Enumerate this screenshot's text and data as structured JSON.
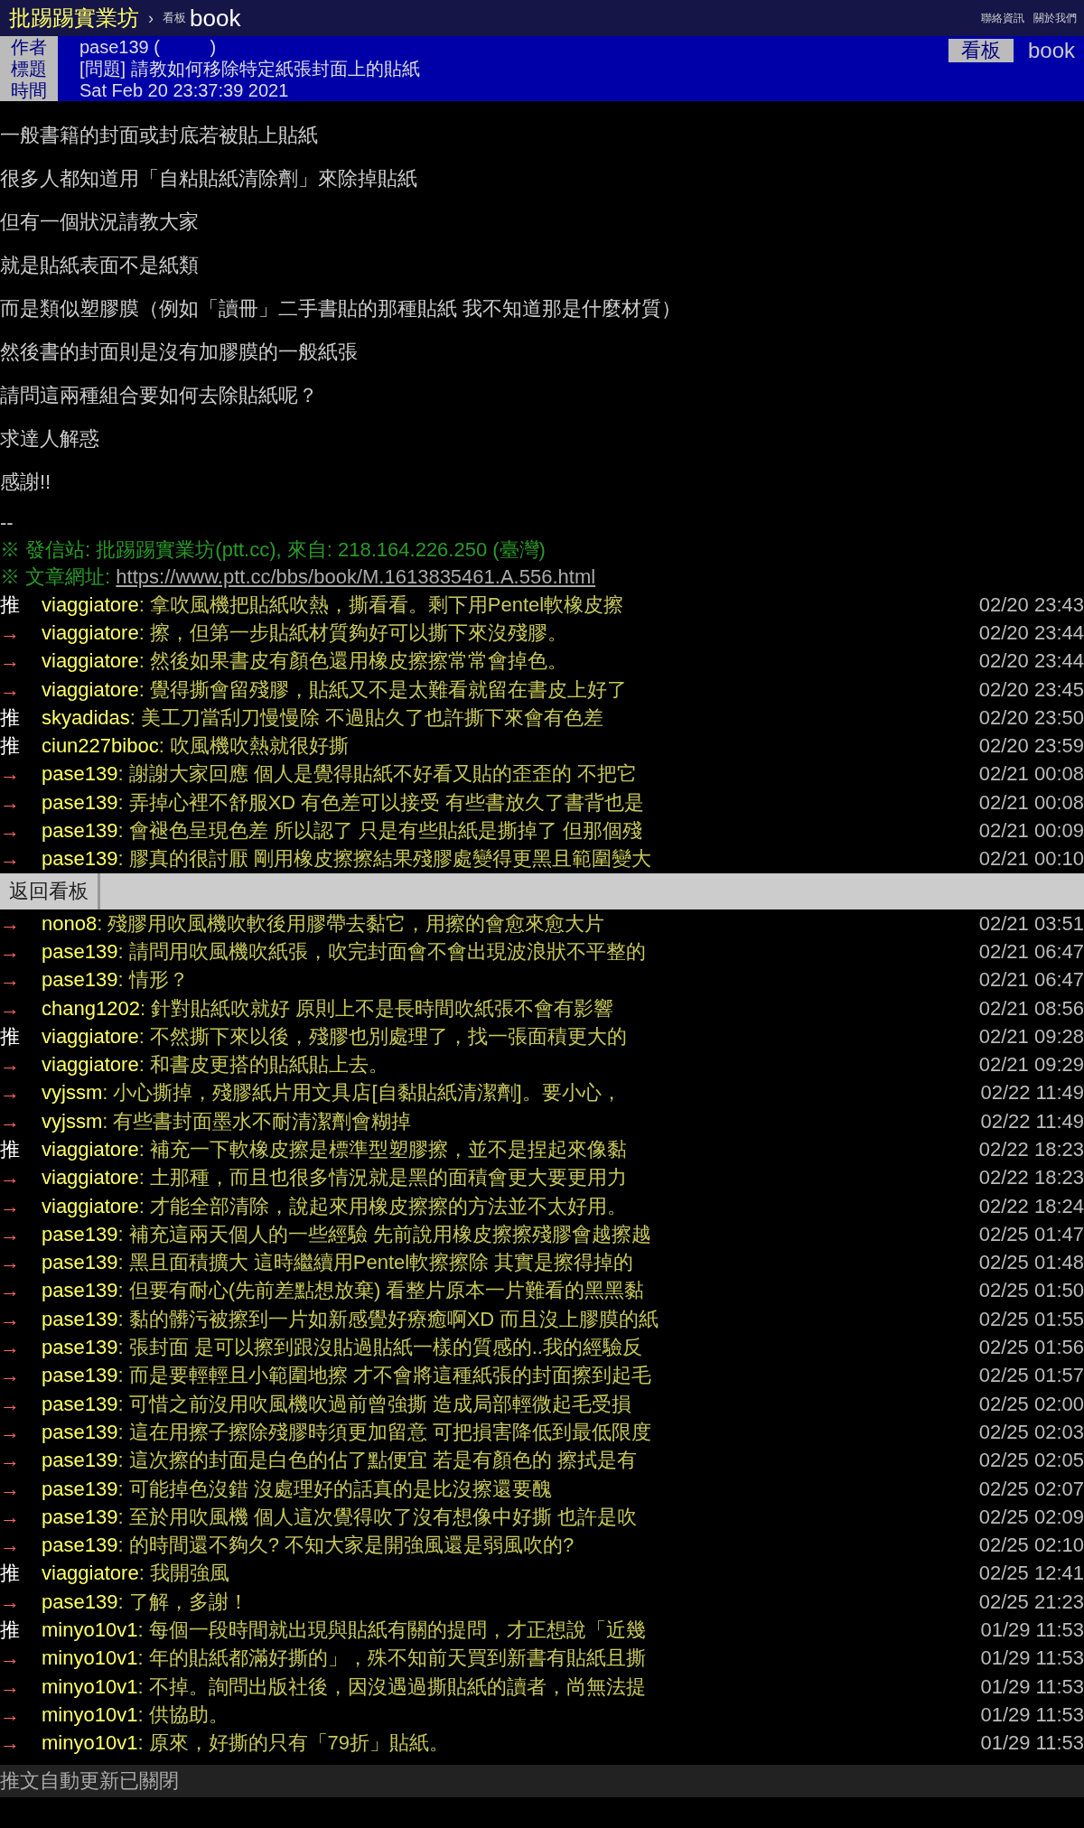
{
  "topbar": {
    "site": "批踢踢實業坊",
    "separator": "›",
    "board_label": "看板",
    "board": "book",
    "links": [
      "聯絡資訊",
      "關於我們"
    ]
  },
  "meta": {
    "rows": [
      {
        "label": "作者",
        "value": "pase139 (          )"
      },
      {
        "label": "標題",
        "value": "[問題] 請教如何移除特定紙張封面上的貼紙"
      },
      {
        "label": "時間",
        "value": "Sat Feb 20 23:37:39 2021"
      }
    ],
    "board_tag": {
      "label": "看板",
      "value": "book"
    }
  },
  "body": [
    "一般書籍的封面或封底若被貼上貼紙",
    "很多人都知道用「自粘貼紙清除劑」來除掉貼紙",
    "但有一個狀況請教大家",
    "就是貼紙表面不是紙類",
    "而是類似塑膠膜（例如「讀冊」二手書貼的那種貼紙 我不知道那是什麼材質）",
    "然後書的封面則是沒有加膠膜的一般紙張",
    "請問這兩種組合要如何去除貼紙呢？",
    "求達人解惑",
    "感謝!!"
  ],
  "signature": "--",
  "source_lines": [
    {
      "kind": "text",
      "label": "※ 發信站:",
      "value": "批踢踢實業坊(ptt.cc), 來自: 218.164.226.250 (臺灣)"
    },
    {
      "kind": "link",
      "label": "※ 文章網址:",
      "value": "https://www.ptt.cc/bbs/book/M.1613835461.A.556.html"
    }
  ],
  "pushes": [
    {
      "kind": "push",
      "tag": "推",
      "user": "viaggiatore",
      "content": ": 拿吹風機把貼紙吹熱，撕看看。剩下用Pentel軟橡皮擦",
      "time": "02/20 23:43"
    },
    {
      "kind": "arrow",
      "tag": "→",
      "user": "viaggiatore",
      "content": ": 擦，但第一步貼紙材質夠好可以撕下來沒殘膠。",
      "time": "02/20 23:44"
    },
    {
      "kind": "arrow",
      "tag": "→",
      "user": "viaggiatore",
      "content": ": 然後如果書皮有顏色還用橡皮擦擦常常會掉色。",
      "time": "02/20 23:44"
    },
    {
      "kind": "arrow",
      "tag": "→",
      "user": "viaggiatore",
      "content": ": 覺得撕會留殘膠，貼紙又不是太難看就留在書皮上好了",
      "time": "02/20 23:45"
    },
    {
      "kind": "push",
      "tag": "推",
      "user": "skyadidas",
      "content": ": 美工刀當刮刀慢慢除 不過貼久了也許撕下來會有色差",
      "time": "02/20 23:50"
    },
    {
      "kind": "push",
      "tag": "推",
      "user": "ciun227biboc",
      "content": ": 吹風機吹熱就很好撕",
      "time": "02/20 23:59"
    },
    {
      "kind": "arrow",
      "tag": "→",
      "user": "pase139",
      "content": ": 謝謝大家回應 個人是覺得貼紙不好看又貼的歪歪的 不把它",
      "time": "02/21 00:08"
    },
    {
      "kind": "arrow",
      "tag": "→",
      "user": "pase139",
      "content": ": 弄掉心裡不舒服XD 有色差可以接受 有些書放久了書背也是",
      "time": "02/21 00:08"
    },
    {
      "kind": "arrow",
      "tag": "→",
      "user": "pase139",
      "content": ": 會褪色呈現色差 所以認了 只是有些貼紙是撕掉了 但那個殘",
      "time": "02/21 00:09"
    },
    {
      "kind": "arrow",
      "tag": "→",
      "user": "pase139",
      "content": ": 膠真的很討厭 剛用橡皮擦擦結果殘膠處變得更黑且範圍變大",
      "time": "02/21 00:10"
    }
  ],
  "back_bar": {
    "label": "返回看板"
  },
  "more_pushes": [
    {
      "kind": "arrow",
      "tag": "→",
      "user": "nono8",
      "content": ": 殘膠用吹風機吹軟後用膠帶去黏它，用擦的會愈來愈大片",
      "time": "02/21 03:51"
    },
    {
      "kind": "arrow",
      "tag": "→",
      "user": "pase139",
      "content": ": 請問用吹風機吹紙張，吹完封面會不會出現波浪狀不平整的",
      "time": "02/21 06:47"
    },
    {
      "kind": "arrow",
      "tag": "→",
      "user": "pase139",
      "content": ": 情形？",
      "time": "02/21 06:47"
    },
    {
      "kind": "arrow",
      "tag": "→",
      "user": "chang1202",
      "content": ": 針對貼紙吹就好 原則上不是長時間吹紙張不會有影響",
      "time": "02/21 08:56"
    },
    {
      "kind": "push",
      "tag": "推",
      "user": "viaggiatore",
      "content": ": 不然撕下來以後，殘膠也別處理了，找一張面積更大的",
      "time": "02/21 09:28"
    },
    {
      "kind": "arrow",
      "tag": "→",
      "user": "viaggiatore",
      "content": ": 和書皮更搭的貼紙貼上去。",
      "time": "02/21 09:29"
    },
    {
      "kind": "arrow",
      "tag": "→",
      "user": "vyjssm",
      "content": ": 小心撕掉，殘膠紙片用文具店[自黏貼紙清潔劑]。要小心，",
      "time": "02/22 11:49"
    },
    {
      "kind": "arrow",
      "tag": "→",
      "user": "vyjssm",
      "content": ": 有些書封面墨水不耐清潔劑會糊掉",
      "time": "02/22 11:49"
    },
    {
      "kind": "push",
      "tag": "推",
      "user": "viaggiatore",
      "content": ": 補充一下軟橡皮擦是標準型塑膠擦，並不是捏起來像黏",
      "time": "02/22 18:23"
    },
    {
      "kind": "arrow",
      "tag": "→",
      "user": "viaggiatore",
      "content": ": 土那種，而且也很多情況就是黑的面積會更大要更用力",
      "time": "02/22 18:23"
    },
    {
      "kind": "arrow",
      "tag": "→",
      "user": "viaggiatore",
      "content": ": 才能全部清除，說起來用橡皮擦擦的方法並不太好用。",
      "time": "02/22 18:24"
    },
    {
      "kind": "arrow",
      "tag": "→",
      "user": "pase139",
      "content": ": 補充這兩天個人的一些經驗 先前說用橡皮擦擦殘膠會越擦越",
      "time": "02/25 01:47"
    },
    {
      "kind": "arrow",
      "tag": "→",
      "user": "pase139",
      "content": ": 黑且面積擴大 這時繼續用Pentel軟擦擦除 其實是擦得掉的",
      "time": "02/25 01:48"
    },
    {
      "kind": "arrow",
      "tag": "→",
      "user": "pase139",
      "content": ": 但要有耐心(先前差點想放棄) 看整片原本一片難看的黑黑黏",
      "time": "02/25 01:50"
    },
    {
      "kind": "arrow",
      "tag": "→",
      "user": "pase139",
      "content": ": 黏的髒污被擦到一片如新感覺好療癒啊XD 而且沒上膠膜的紙",
      "time": "02/25 01:55"
    },
    {
      "kind": "arrow",
      "tag": "→",
      "user": "pase139",
      "content": ": 張封面 是可以擦到跟沒貼過貼紙一樣的質感的..我的經驗反",
      "time": "02/25 01:56"
    },
    {
      "kind": "arrow",
      "tag": "→",
      "user": "pase139",
      "content": ": 而是要輕輕且小範圍地擦 才不會將這種紙張的封面擦到起毛",
      "time": "02/25 01:57"
    },
    {
      "kind": "arrow",
      "tag": "→",
      "user": "pase139",
      "content": ": 可惜之前沒用吹風機吹過前曾強撕 造成局部輕微起毛受損",
      "time": "02/25 02:00"
    },
    {
      "kind": "arrow",
      "tag": "→",
      "user": "pase139",
      "content": ": 這在用擦子擦除殘膠時須更加留意 可把損害降低到最低限度",
      "time": "02/25 02:03"
    },
    {
      "kind": "arrow",
      "tag": "→",
      "user": "pase139",
      "content": ": 這次擦的封面是白色的佔了點便宜 若是有顏色的 擦拭是有",
      "time": "02/25 02:05"
    },
    {
      "kind": "arrow",
      "tag": "→",
      "user": "pase139",
      "content": ": 可能掉色沒錯 沒處理好的話真的是比沒擦還要醜",
      "time": "02/25 02:07"
    },
    {
      "kind": "arrow",
      "tag": "→",
      "user": "pase139",
      "content": ": 至於用吹風機 個人這次覺得吹了沒有想像中好撕 也許是吹",
      "time": "02/25 02:09"
    },
    {
      "kind": "arrow",
      "tag": "→",
      "user": "pase139",
      "content": ": 的時間還不夠久? 不知大家是開強風還是弱風吹的?",
      "time": "02/25 02:10"
    },
    {
      "kind": "push",
      "tag": "推",
      "user": "viaggiatore",
      "content": ": 我開強風",
      "time": "02/25 12:41"
    },
    {
      "kind": "arrow",
      "tag": "→",
      "user": "pase139",
      "content": ": 了解，多謝！",
      "time": "02/25 21:23"
    },
    {
      "kind": "push",
      "tag": "推",
      "user": "minyo10v1",
      "content": ": 每個一段時間就出現與貼紙有關的提問，才正想說「近幾",
      "time": "01/29 11:53"
    },
    {
      "kind": "arrow",
      "tag": "→",
      "user": "minyo10v1",
      "content": ": 年的貼紙都滿好撕的」，殊不知前天買到新書有貼紙且撕",
      "time": "01/29 11:53"
    },
    {
      "kind": "arrow",
      "tag": "→",
      "user": "minyo10v1",
      "content": ": 不掉。詢問出版社後，因沒遇過撕貼紙的讀者，尚無法提",
      "time": "01/29 11:53"
    },
    {
      "kind": "arrow",
      "tag": "→",
      "user": "minyo10v1",
      "content": ": 供協助。",
      "time": "01/29 11:53"
    },
    {
      "kind": "arrow",
      "tag": "→",
      "user": "minyo10v1",
      "content": ": 原來，好撕的只有「79折」貼紙。",
      "time": "01/29 11:53"
    }
  ],
  "footer": "推文自動更新已關閉"
}
